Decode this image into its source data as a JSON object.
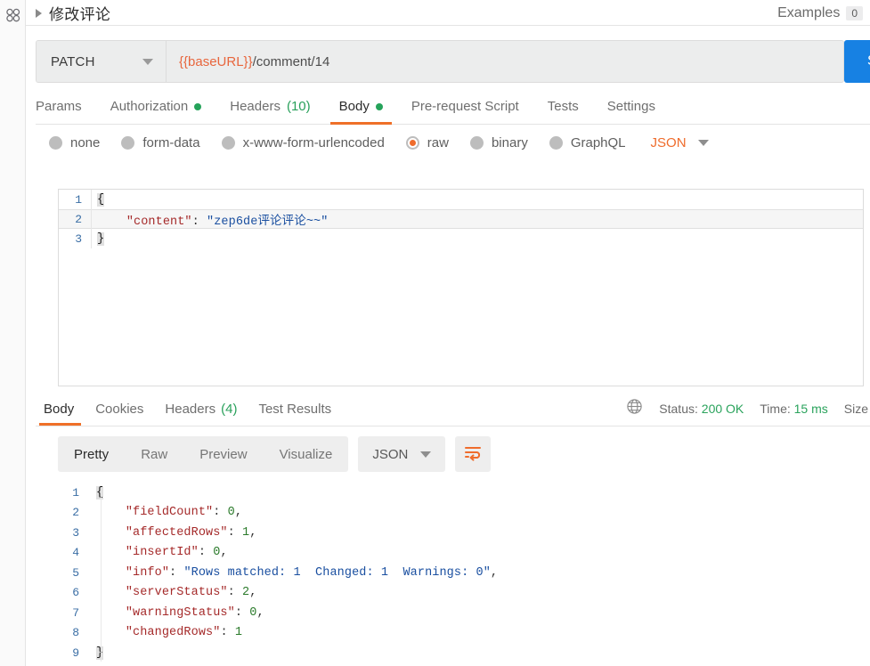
{
  "left_rail": {
    "icon": "collections-icon"
  },
  "request": {
    "title": "修改评论",
    "collapse_icon": "caret-right-icon",
    "examples_label": "Examples",
    "examples_count": "0",
    "method": "PATCH",
    "method_caret_icon": "chevron-down-icon",
    "url_variable": "{{baseURL}}",
    "url_path": "/comment/14",
    "send_label": "Send",
    "tabs": [
      {
        "label": "Params",
        "indicator": "",
        "count": "",
        "active": false
      },
      {
        "label": "Authorization",
        "indicator": "dot",
        "count": "",
        "active": false
      },
      {
        "label": "Headers",
        "indicator": "",
        "count": "(10)",
        "active": false
      },
      {
        "label": "Body",
        "indicator": "dot",
        "count": "",
        "active": true
      },
      {
        "label": "Pre-request Script",
        "indicator": "",
        "count": "",
        "active": false
      },
      {
        "label": "Tests",
        "indicator": "",
        "count": "",
        "active": false
      },
      {
        "label": "Settings",
        "indicator": "",
        "count": "",
        "active": false
      }
    ],
    "body_types": [
      {
        "label": "none",
        "selected": false
      },
      {
        "label": "form-data",
        "selected": false
      },
      {
        "label": "x-www-form-urlencoded",
        "selected": false
      },
      {
        "label": "raw",
        "selected": true
      },
      {
        "label": "binary",
        "selected": false
      },
      {
        "label": "GraphQL",
        "selected": false
      }
    ],
    "raw_format": "JSON",
    "raw_format_caret_icon": "chevron-down-icon",
    "body_lines": [
      {
        "n": "1",
        "open_brace": "{"
      },
      {
        "n": "2",
        "key": "\"content\"",
        "colon": ": ",
        "value": "\"zep6de评论评论~~\""
      },
      {
        "n": "3",
        "close_brace": "}"
      }
    ]
  },
  "response": {
    "tabs": [
      {
        "label": "Body",
        "count": "",
        "active": true
      },
      {
        "label": "Cookies",
        "count": "",
        "active": false
      },
      {
        "label": "Headers",
        "count": "(4)",
        "active": false
      },
      {
        "label": "Test Results",
        "count": "",
        "active": false
      }
    ],
    "globe_icon": "globe-icon",
    "status_label": "Status:",
    "status_value": "200 OK",
    "time_label": "Time:",
    "time_value": "15 ms",
    "size_label": "Size",
    "view_modes": [
      {
        "label": "Pretty",
        "active": true
      },
      {
        "label": "Raw",
        "active": false
      },
      {
        "label": "Preview",
        "active": false
      },
      {
        "label": "Visualize",
        "active": false
      }
    ],
    "format": "JSON",
    "format_caret_icon": "chevron-down-icon",
    "wrap_icon": "word-wrap-icon",
    "body_lines": [
      {
        "n": "1",
        "open_brace": "{"
      },
      {
        "n": "2",
        "key": "\"fieldCount\"",
        "value": "0",
        "type": "num",
        "comma": ","
      },
      {
        "n": "3",
        "key": "\"affectedRows\"",
        "value": "1",
        "type": "num",
        "comma": ","
      },
      {
        "n": "4",
        "key": "\"insertId\"",
        "value": "0",
        "type": "num",
        "comma": ","
      },
      {
        "n": "5",
        "key": "\"info\"",
        "value": "\"Rows matched: 1  Changed: 1  Warnings: 0\"",
        "type": "str",
        "comma": ","
      },
      {
        "n": "6",
        "key": "\"serverStatus\"",
        "value": "2",
        "type": "num",
        "comma": ","
      },
      {
        "n": "7",
        "key": "\"warningStatus\"",
        "value": "0",
        "type": "num",
        "comma": ","
      },
      {
        "n": "8",
        "key": "\"changedRows\"",
        "value": "1",
        "type": "num",
        "comma": ""
      },
      {
        "n": "9",
        "close_brace": "}"
      }
    ]
  },
  "colors": {
    "accent_orange": "#ef7028",
    "send_blue": "#1781e3",
    "status_green": "#2aa35c",
    "indicator_green": "#25a35a"
  }
}
